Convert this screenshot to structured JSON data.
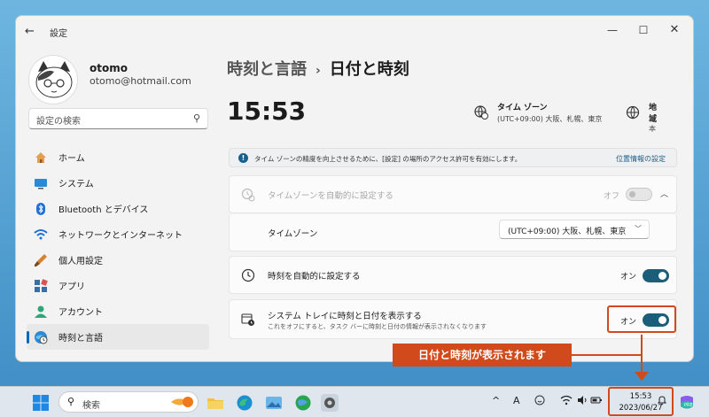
{
  "window": {
    "title": "設定",
    "back": "←",
    "min": "—",
    "max": "☐",
    "close": "✕"
  },
  "user": {
    "name": "otomo",
    "email": "otomo@hotmail.com"
  },
  "search": {
    "placeholder": "設定の検索"
  },
  "sidebar": {
    "items": [
      {
        "label": "ホーム",
        "icon": "home-icon"
      },
      {
        "label": "システム",
        "icon": "system-icon"
      },
      {
        "label": "Bluetooth とデバイス",
        "icon": "bluetooth-icon"
      },
      {
        "label": "ネットワークとインターネット",
        "icon": "wifi-icon"
      },
      {
        "label": "個人用設定",
        "icon": "brush-icon"
      },
      {
        "label": "アプリ",
        "icon": "apps-icon"
      },
      {
        "label": "アカウント",
        "icon": "account-icon"
      },
      {
        "label": "時刻と言語",
        "icon": "time-language-icon",
        "active": true
      }
    ]
  },
  "breadcrumb": {
    "parent": "時刻と言語",
    "sep": "›",
    "current": "日付と時刻"
  },
  "clock": "15:53",
  "timezone_summary": {
    "title": "タイム ゾーン",
    "value": "(UTC+09:00) 大阪、札幌、東京"
  },
  "region_summary": {
    "title": "地域",
    "value": "日本"
  },
  "info_bar": {
    "text": "タイム ゾーンの精度を向上させるために、[設定] の場所のアクセス許可を有効にします。",
    "link": "位置情報の設定"
  },
  "settings": {
    "auto_tz": {
      "label": "タイムゾーンを自動的に設定する",
      "state": "オフ"
    },
    "timezone": {
      "label": "タイムゾーン",
      "value": "(UTC+09:00) 大阪、札幌、東京"
    },
    "auto_time": {
      "label": "時刻を自動的に設定する",
      "state": "オン"
    },
    "tray": {
      "label": "システム トレイに時刻と日付を表示する",
      "sub": "これをオフにすると、タスク バーに時刻と日付の情報が表示されなくなります",
      "state": "オン"
    }
  },
  "callout": "日付と時刻が表示されます",
  "taskbar": {
    "search_placeholder": "検索",
    "time": "15:53",
    "date": "2023/06/27",
    "tray_caret": "^",
    "ime": "A"
  },
  "colors": {
    "accent": "#1b5e7a",
    "callout": "#d14a1c"
  }
}
